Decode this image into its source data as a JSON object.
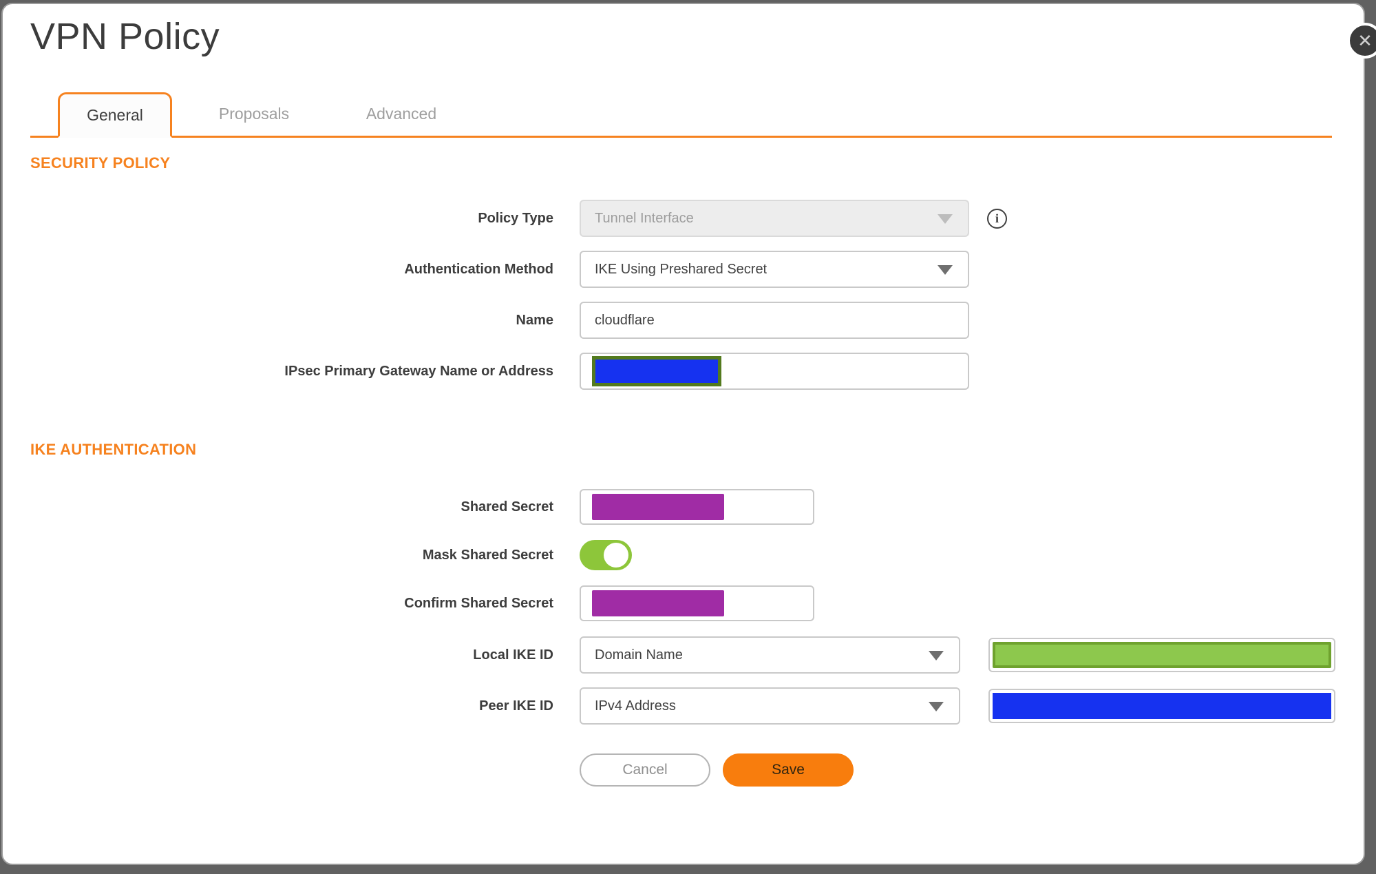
{
  "dialog": {
    "title": "VPN Policy"
  },
  "icons": {
    "close_glyph": "✕",
    "info_glyph": "i"
  },
  "tabs": [
    {
      "label": "General",
      "active": true
    },
    {
      "label": "Proposals",
      "active": false
    },
    {
      "label": "Advanced",
      "active": false
    }
  ],
  "security_policy": {
    "heading": "SECURITY POLICY",
    "policy_type": {
      "label": "Policy Type",
      "value": "Tunnel Interface",
      "disabled": true
    },
    "authentication_method": {
      "label": "Authentication Method",
      "value": "IKE Using Preshared Secret"
    },
    "name": {
      "label": "Name",
      "value": "cloudflare"
    },
    "gateway": {
      "label": "IPsec Primary Gateway Name or Address",
      "value": "",
      "value_redacted": true
    }
  },
  "ike_authentication": {
    "heading": "IKE AUTHENTICATION",
    "shared_secret": {
      "label": "Shared Secret",
      "value_redacted": true
    },
    "mask_shared_secret": {
      "label": "Mask Shared Secret",
      "enabled": true
    },
    "confirm_shared_secret": {
      "label": "Confirm Shared Secret",
      "value_redacted": true
    },
    "local_ike_id": {
      "label": "Local IKE ID",
      "value": "Domain Name",
      "id_value_redacted": true
    },
    "peer_ike_id": {
      "label": "Peer IKE ID",
      "value": "IPv4 Address",
      "id_value_redacted": true
    }
  },
  "actions": {
    "cancel_label": "Cancel",
    "save_label": "Save"
  },
  "colors": {
    "accent_orange": "#F6821F",
    "save_button_orange": "#F87D0D",
    "redaction_purple": "#A02CA5",
    "redaction_blue": "#1632F0",
    "redaction_green": "#8DC84D",
    "redaction_green_border": "#6FA22E",
    "redaction_olive_border": "#537A1E",
    "toggle_green": "#8DC63A",
    "backdrop_gray": "#616161",
    "disabled_field_gray": "#EDEDED"
  }
}
